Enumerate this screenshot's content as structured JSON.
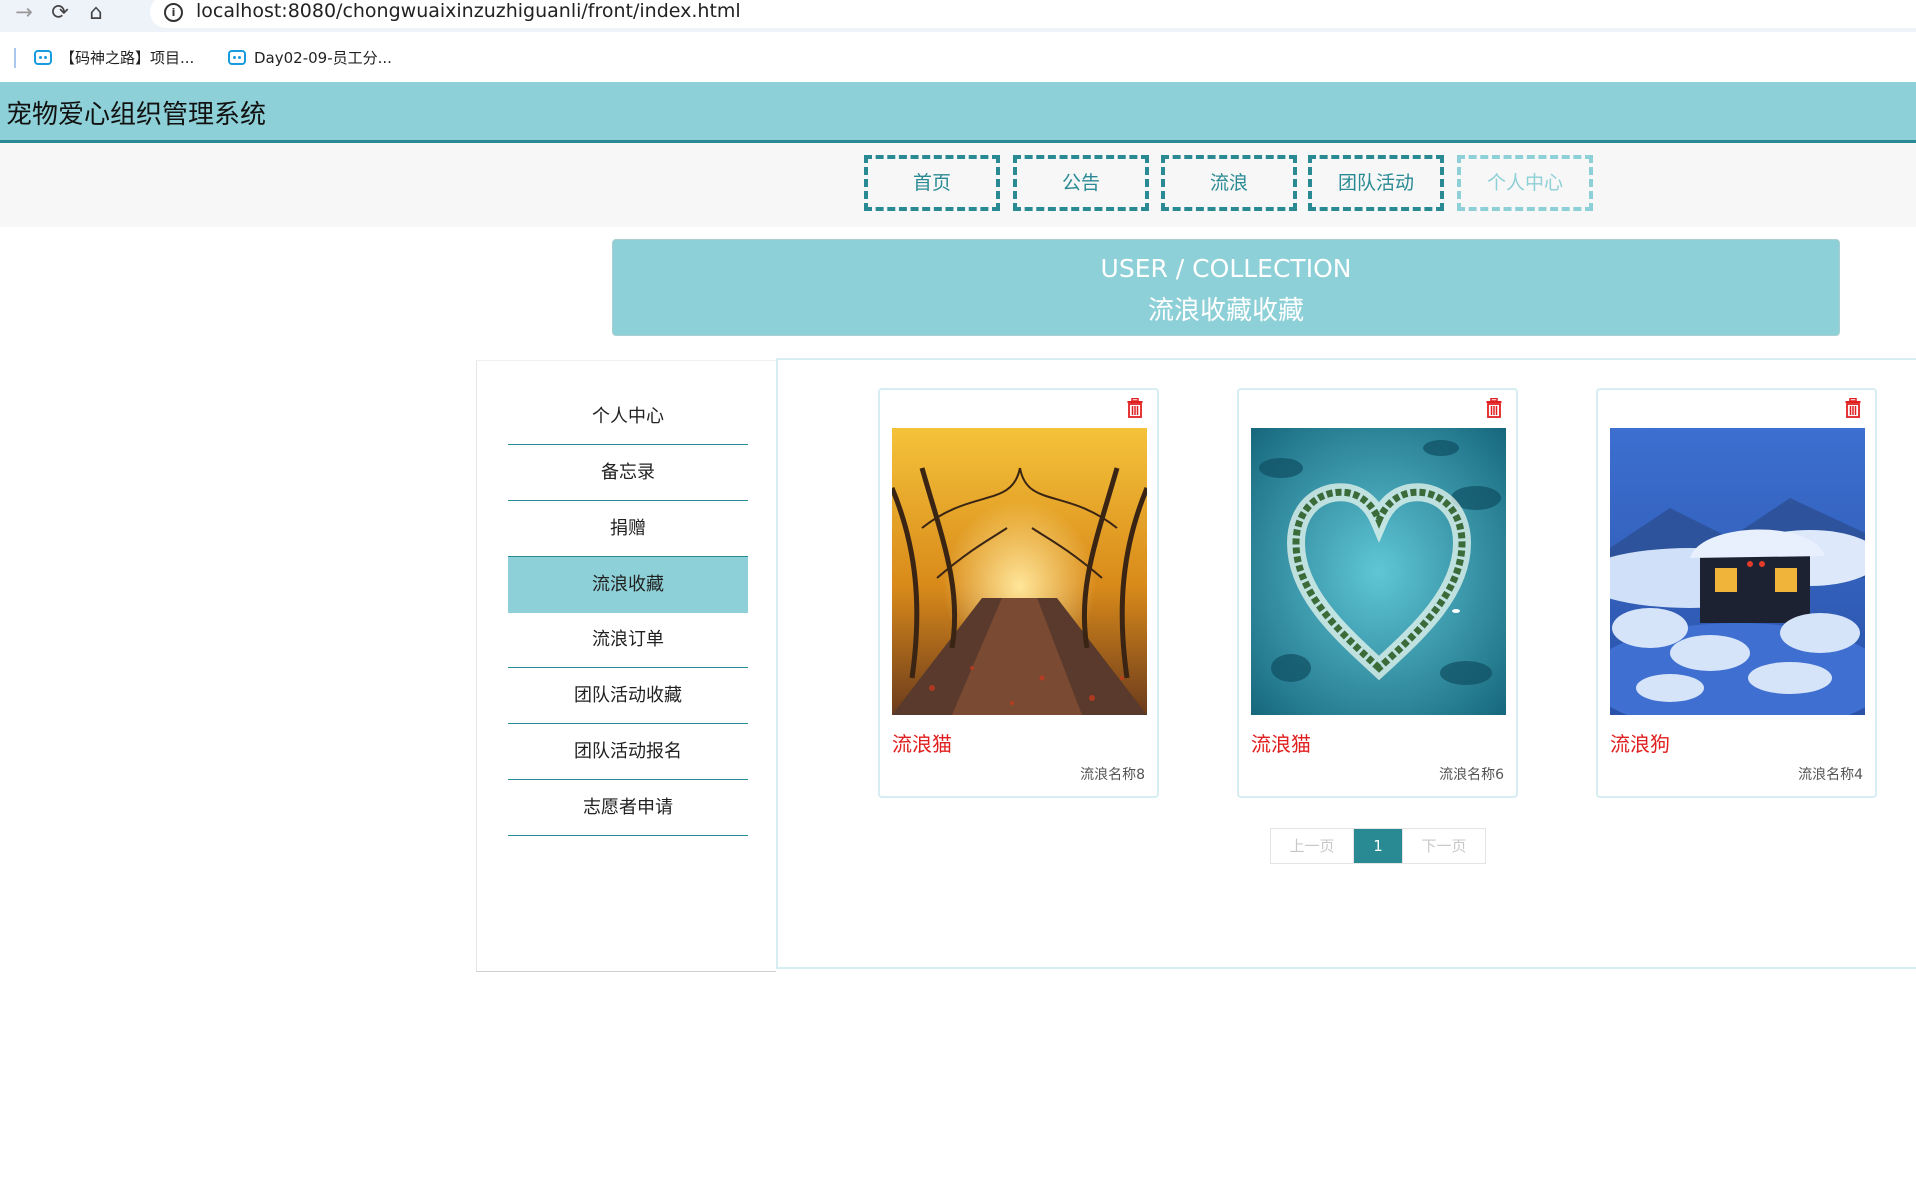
{
  "browser": {
    "url": "localhost:8080/chongwuaixinzuzhiguanli/front/index.html",
    "bookmarks": [
      "【码神之路】项目...",
      "Day02-09-员工分..."
    ]
  },
  "header": {
    "title": "宠物爱心组织管理系统"
  },
  "nav": {
    "items": [
      "首页",
      "公告",
      "流浪",
      "团队活动",
      "个人中心"
    ],
    "active": "个人中心"
  },
  "banner": {
    "en": "USER / COLLECTION",
    "cn": "流浪收藏收藏"
  },
  "sidebar": {
    "items": [
      "个人中心",
      "备忘录",
      "捐赠",
      "流浪收藏",
      "流浪订单",
      "团队活动收藏",
      "团队活动报名",
      "志愿者申请"
    ],
    "active": "流浪收藏"
  },
  "cards": [
    {
      "name": "流浪猫",
      "subtitle": "流浪名称8",
      "image": "autumn-tree-avenue"
    },
    {
      "name": "流浪猫",
      "subtitle": "流浪名称6",
      "image": "heart-island"
    },
    {
      "name": "流浪狗",
      "subtitle": "流浪名称4",
      "image": "snow-cabin-night"
    }
  ],
  "pagination": {
    "prev": "上一页",
    "current": "1",
    "next": "下一页"
  },
  "colors": {
    "accent": "#8ed0d7",
    "dark_teal": "#2a8a93",
    "card_title": "#e02020"
  }
}
